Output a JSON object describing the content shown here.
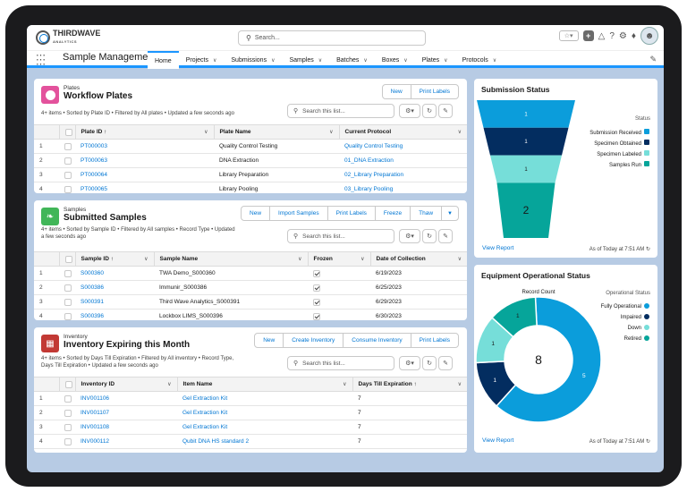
{
  "app": {
    "logo_main": "THIRDWAVE",
    "logo_sub": "ANALYTICS",
    "search_placeholder": "Search...",
    "name": "Sample Management"
  },
  "nav": {
    "tabs": [
      {
        "label": "Home",
        "dropdown": false,
        "active": true
      },
      {
        "label": "Projects",
        "dropdown": true
      },
      {
        "label": "Submissions",
        "dropdown": true
      },
      {
        "label": "Samples",
        "dropdown": true
      },
      {
        "label": "Batches",
        "dropdown": true
      },
      {
        "label": "Boxes",
        "dropdown": true
      },
      {
        "label": "Plates",
        "dropdown": true
      },
      {
        "label": "Protocols",
        "dropdown": true
      }
    ]
  },
  "plates": {
    "type_label": "Plates",
    "title": "Workflow Plates",
    "meta": "4+ items • Sorted by Plate ID • Filtered by All plates • Updated a few seconds ago",
    "buttons": [
      "New",
      "Print Labels"
    ],
    "search_placeholder": "Search this list...",
    "columns": [
      "Plate ID ↑",
      "Plate Name",
      "Current Protocol"
    ],
    "rows": [
      {
        "n": "1",
        "id": "PT000003",
        "name": "Quality Control Testing",
        "protocol": "Quality Control Testing"
      },
      {
        "n": "2",
        "id": "PT000063",
        "name": "DNA Extraction",
        "protocol": "01_DNA Extraction"
      },
      {
        "n": "3",
        "id": "PT000064",
        "name": "Library Preparation",
        "protocol": "02_Library Preparation"
      },
      {
        "n": "4",
        "id": "PT000065",
        "name": "Library Pooling",
        "protocol": "03_Library Pooling"
      }
    ]
  },
  "samples": {
    "type_label": "Samples",
    "title": "Submitted Samples",
    "meta_line1": "4+ items • Sorted by Sample ID • Filtered by All samples • Record Type • Updated",
    "meta_line2": "a few seconds ago",
    "buttons": [
      "New",
      "Import Samples",
      "Print Labels",
      "Freeze",
      "Thaw"
    ],
    "search_placeholder": "Search this list...",
    "columns": [
      "Sample ID ↑",
      "Sample Name",
      "Frozen",
      "Date of Collection"
    ],
    "rows": [
      {
        "n": "1",
        "id": "S000360",
        "name": "TWA Demo_S000360",
        "frozen": true,
        "date": "6/19/2023"
      },
      {
        "n": "2",
        "id": "S000386",
        "name": "Immunir_S000386",
        "frozen": true,
        "date": "6/25/2023"
      },
      {
        "n": "3",
        "id": "S000391",
        "name": "Third Wave Analytics_S000391",
        "frozen": true,
        "date": "6/29/2023"
      },
      {
        "n": "4",
        "id": "S000396",
        "name": "Lockbox LIMS_S000396",
        "frozen": true,
        "date": "6/30/2023"
      }
    ]
  },
  "inventory": {
    "type_label": "Inventory",
    "title": "Inventory Expiring this Month",
    "meta_line1": "4+ items • Sorted by Days Till Expiration • Filtered by All inventory • Record Type,",
    "meta_line2": "Days Till Expiration • Updated a few seconds ago",
    "buttons": [
      "New",
      "Create Inventory",
      "Consume Inventory",
      "Print Labels"
    ],
    "search_placeholder": "Search this list...",
    "columns": [
      "Inventory ID",
      "Item Name",
      "Days Till Expiration ↑"
    ],
    "rows": [
      {
        "n": "1",
        "id": "INV001106",
        "name": "Gel Extraction Kit",
        "days": "7"
      },
      {
        "n": "2",
        "id": "INV001107",
        "name": "Gel Extraction Kit",
        "days": "7"
      },
      {
        "n": "3",
        "id": "INV001108",
        "name": "Gel Extraction Kit",
        "days": "7"
      },
      {
        "n": "4",
        "id": "INV000112",
        "name": "Qubit DNA HS standard 2",
        "days": "7"
      }
    ]
  },
  "submission_status": {
    "title": "Submission Status",
    "legend_title": "Status",
    "view_report": "View Report",
    "as_of": "As of Today at 7:51 AM",
    "colors": [
      "#0b9ddb",
      "#032d60",
      "#76ded9",
      "#06a59a"
    ]
  },
  "equipment_status": {
    "title": "Equipment Operational Status",
    "measure_label": "Record Count",
    "legend_title": "Operational Status",
    "total": "8",
    "view_report": "View Report",
    "as_of": "As of Today at 7:51 AM",
    "colors": [
      "#0b9ddb",
      "#032d60",
      "#76ded9",
      "#06a59a"
    ]
  },
  "chart_data": [
    {
      "type": "funnel",
      "title": "Submission Status",
      "categories": [
        "Submission Received",
        "Specimen Obtained",
        "Specimen Labeled",
        "Samples Run"
      ],
      "values": [
        1,
        1,
        1,
        2
      ],
      "legend": "right"
    },
    {
      "type": "pie",
      "title": "Equipment Operational Status",
      "measure": "Record Count",
      "categories": [
        "Fully Operational",
        "Impaired",
        "Down",
        "Retired"
      ],
      "values": [
        5,
        1,
        1,
        1
      ],
      "total": 8,
      "legend": "right"
    }
  ]
}
